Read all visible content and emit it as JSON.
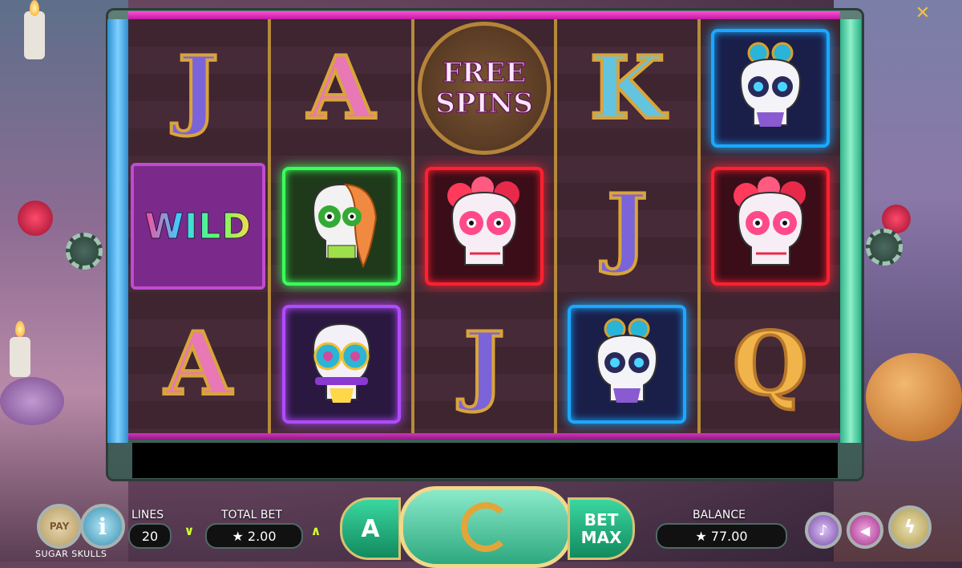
{
  "game": {
    "title": "SUGAR SKULLS"
  },
  "reels": [
    [
      {
        "symbol": "J"
      },
      {
        "symbol": "WILD"
      },
      {
        "symbol": "A"
      }
    ],
    [
      {
        "symbol": "A"
      },
      {
        "symbol": "green-skull"
      },
      {
        "symbol": "purple-skull"
      }
    ],
    [
      {
        "symbol": "FREE SPINS",
        "line1": "FREE",
        "line2": "SPINS"
      },
      {
        "symbol": "red-skull"
      },
      {
        "symbol": "J"
      }
    ],
    [
      {
        "symbol": "K"
      },
      {
        "symbol": "J"
      },
      {
        "symbol": "blue-skull"
      }
    ],
    [
      {
        "symbol": "blue-skull"
      },
      {
        "symbol": "red-skull"
      },
      {
        "symbol": "Q"
      }
    ]
  ],
  "controls": {
    "paytable_label": "PAY",
    "info_label": "i",
    "lines_label": "LINES",
    "lines_value": "20",
    "total_bet_label": "TOTAL BET",
    "total_bet_value": "★ 2.00",
    "autoplay_label": "A",
    "betmax_line1": "BET",
    "betmax_line2": "MAX",
    "balance_label": "BALANCE",
    "balance_value": "★ 77.00"
  },
  "icons": {
    "close": "close-icon",
    "spin": "spin-arrow-icon",
    "sound": "music-note-icon",
    "video": "megaphone-icon",
    "turbo": "lightning-icon"
  },
  "colors": {
    "accent_green": "#3ad7a0",
    "gold": "#f1d88a",
    "rail_pink": "#ff4fd8",
    "rail_blue": "#2f8fcf",
    "rail_teal": "#2fb38a"
  }
}
